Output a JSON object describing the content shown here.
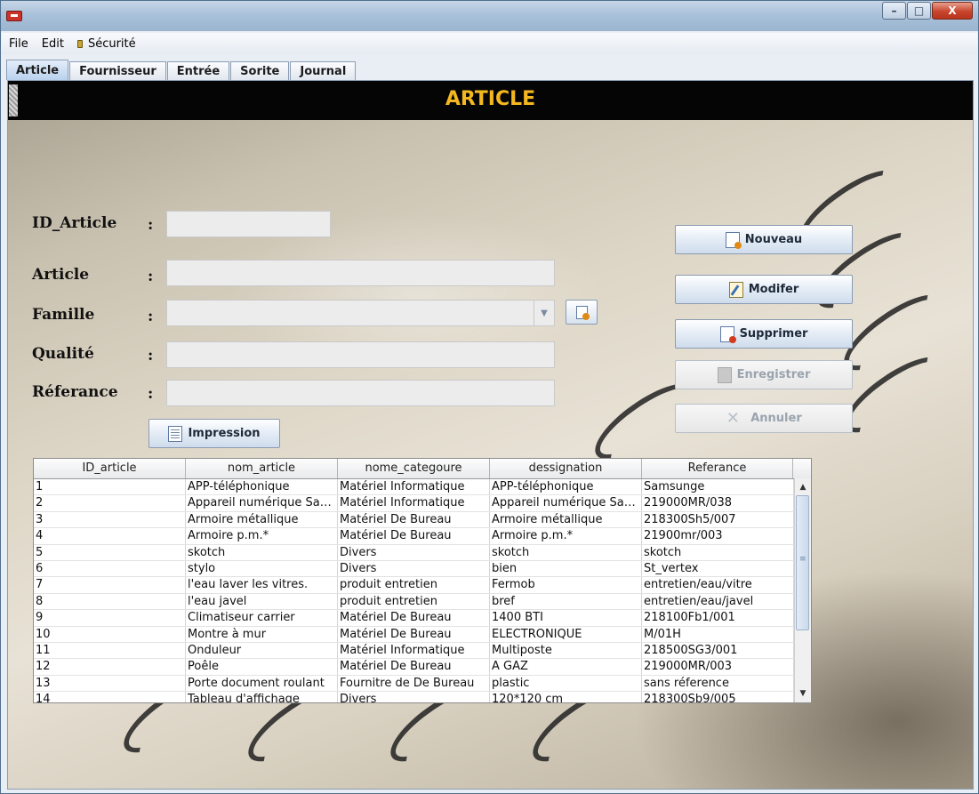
{
  "window": {
    "minimize": "–",
    "maximize": "□",
    "close": "X"
  },
  "menu": [
    "File",
    "Edit",
    "Sécurité"
  ],
  "tabs": [
    "Article",
    "Fournisseur",
    "Entrée",
    "Sorite",
    "Journal"
  ],
  "header_title": "ARTICLE",
  "form": {
    "id_label": "ID_Article",
    "article_label": "Article",
    "famille_label": "Famille",
    "qualite_label": "Qualité",
    "referance_label": "Réferance",
    "colon": ":",
    "id_value": "",
    "article_value": "",
    "famille_value": "",
    "qualite_value": "",
    "referance_value": ""
  },
  "buttons": {
    "nouveau": "Nouveau",
    "modifier": "Modifer",
    "supprimer": "Supprimer",
    "enregistrer": "Enregistrer",
    "annuler": "Annuler",
    "impression": "Impression"
  },
  "table": {
    "columns": [
      "ID_article",
      "nom_article",
      "nome_categoure",
      "dessignation",
      "Referance"
    ],
    "rows": [
      [
        "1",
        "APP-téléphonique",
        "Matériel Informatique",
        "APP-téléphonique",
        "Samsunge"
      ],
      [
        "2",
        "Appareil numérique Sam...",
        "Matériel Informatique",
        "Appareil numérique Sam...",
        "219000MR/038"
      ],
      [
        "3",
        "Armoire métallique",
        "Matériel De Bureau",
        "Armoire métallique",
        "218300Sh5/007"
      ],
      [
        "4",
        "Armoire p.m.*",
        "Matériel De Bureau",
        "Armoire p.m.*",
        "21900mr/003"
      ],
      [
        "5",
        "skotch",
        "Divers",
        "skotch",
        "skotch"
      ],
      [
        "6",
        "stylo",
        "Divers",
        "bien",
        "St_vertex"
      ],
      [
        "7",
        "l'eau laver les vitres.",
        "produit entretien",
        "Fermob",
        "entretien/eau/vitre"
      ],
      [
        "8",
        "l'eau javel",
        "produit entretien",
        "bref",
        "entretien/eau/javel"
      ],
      [
        "9",
        "Climatiseur carrier",
        "Matériel De Bureau",
        "1400 BTI",
        "218100Fb1/001"
      ],
      [
        "10",
        "Montre à mur",
        "Matériel De Bureau",
        "ELECTRONIQUE",
        "M/01H"
      ],
      [
        "11",
        "Onduleur",
        "Matériel Informatique",
        "Multiposte",
        "218500SG3/001"
      ],
      [
        "12",
        "Poêle",
        "Matériel De Bureau",
        "A GAZ",
        "219000MR/003"
      ],
      [
        "13",
        "Porte document roulant",
        "Fournitre de  De Bureau",
        "plastic",
        "sans réference"
      ],
      [
        "14",
        "Tableau d'affichage",
        "Divers",
        "120*120 cm",
        "218300Sb9/005"
      ]
    ]
  },
  "colors": {
    "header_bg": "#050505",
    "header_text": "#f4b71f"
  }
}
